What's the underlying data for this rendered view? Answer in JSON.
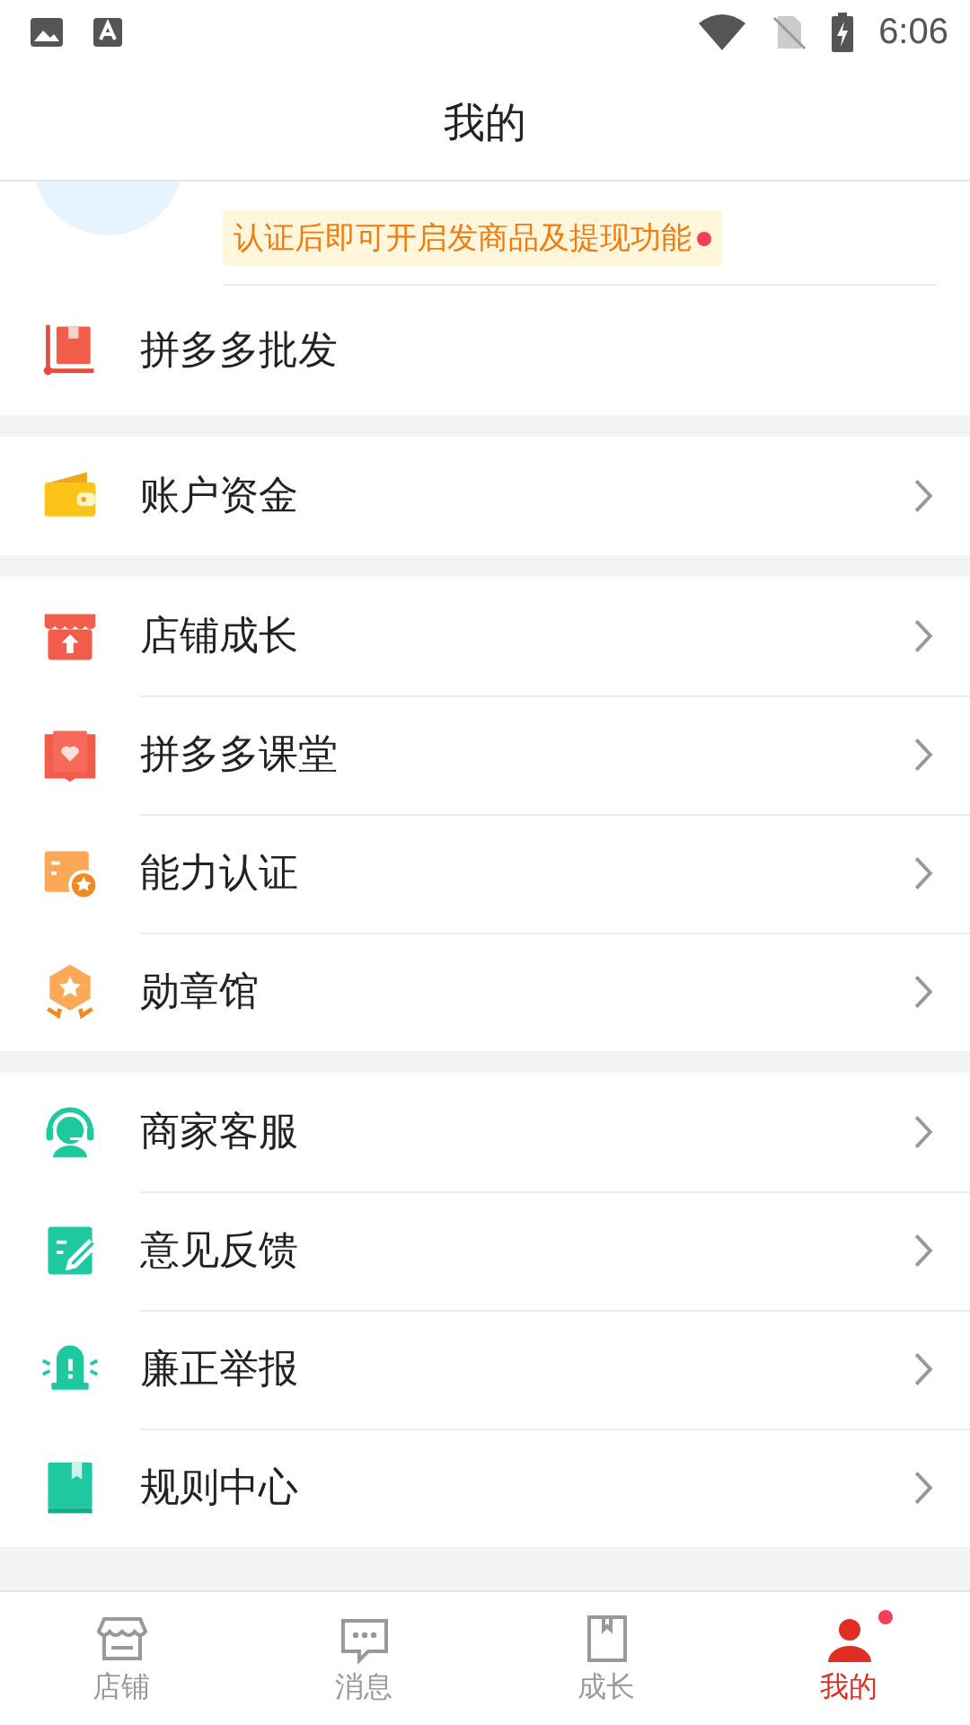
{
  "status_bar": {
    "time": "6:06"
  },
  "title": "我的",
  "profile": {
    "notice": "认证后即可开启发商品及提现功能",
    "notice_dot": true
  },
  "groups": [
    {
      "items": [
        {
          "label": "拼多多批发",
          "kind": "plain"
        }
      ]
    },
    {
      "items": [
        {
          "label": "账户资金",
          "kind": "link"
        }
      ]
    },
    {
      "items": [
        {
          "label": "店铺成长",
          "kind": "link"
        },
        {
          "label": "拼多多课堂",
          "kind": "link"
        },
        {
          "label": "能力认证",
          "kind": "link"
        },
        {
          "label": "勋章馆",
          "kind": "link"
        }
      ]
    },
    {
      "items": [
        {
          "label": "商家客服",
          "kind": "link"
        },
        {
          "label": "意见反馈",
          "kind": "link"
        },
        {
          "label": "廉正举报",
          "kind": "link"
        },
        {
          "label": "规则中心",
          "kind": "link"
        }
      ]
    }
  ],
  "tabs": [
    {
      "label": "店铺",
      "selected": false,
      "badge": false
    },
    {
      "label": "消息",
      "selected": false,
      "badge": false
    },
    {
      "label": "成长",
      "selected": false,
      "badge": false
    },
    {
      "label": "我的",
      "selected": true,
      "badge": true
    }
  ]
}
